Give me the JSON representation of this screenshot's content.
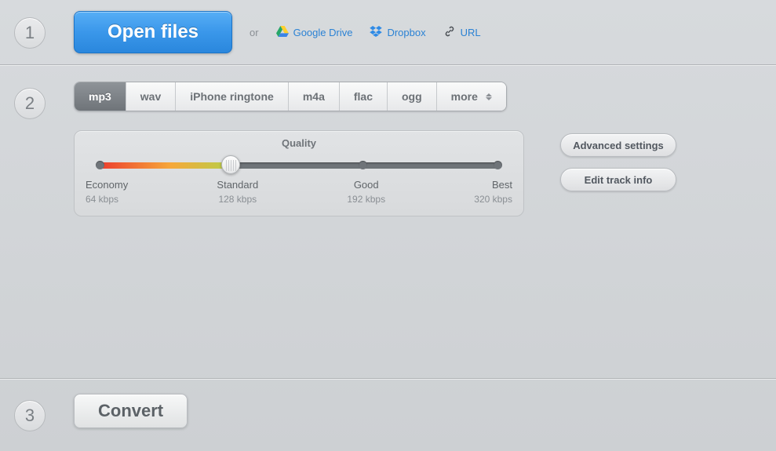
{
  "step1": {
    "number": "1",
    "open_label": "Open files",
    "or": "or",
    "gdrive": "Google Drive",
    "dropbox": "Dropbox",
    "url": "URL"
  },
  "step2": {
    "number": "2",
    "formats": [
      "mp3",
      "wav",
      "iPhone ringtone",
      "m4a",
      "flac",
      "ogg",
      "more"
    ],
    "active_format_index": 0,
    "quality": {
      "title": "Quality",
      "levels": [
        {
          "name": "Economy",
          "rate": "64 kbps"
        },
        {
          "name": "Standard",
          "rate": "128 kbps"
        },
        {
          "name": "Good",
          "rate": "192 kbps"
        },
        {
          "name": "Best",
          "rate": "320 kbps"
        }
      ],
      "selected_index": 1
    },
    "advanced_label": "Advanced settings",
    "edit_track_label": "Edit track info"
  },
  "step3": {
    "number": "3",
    "convert_label": "Convert"
  }
}
